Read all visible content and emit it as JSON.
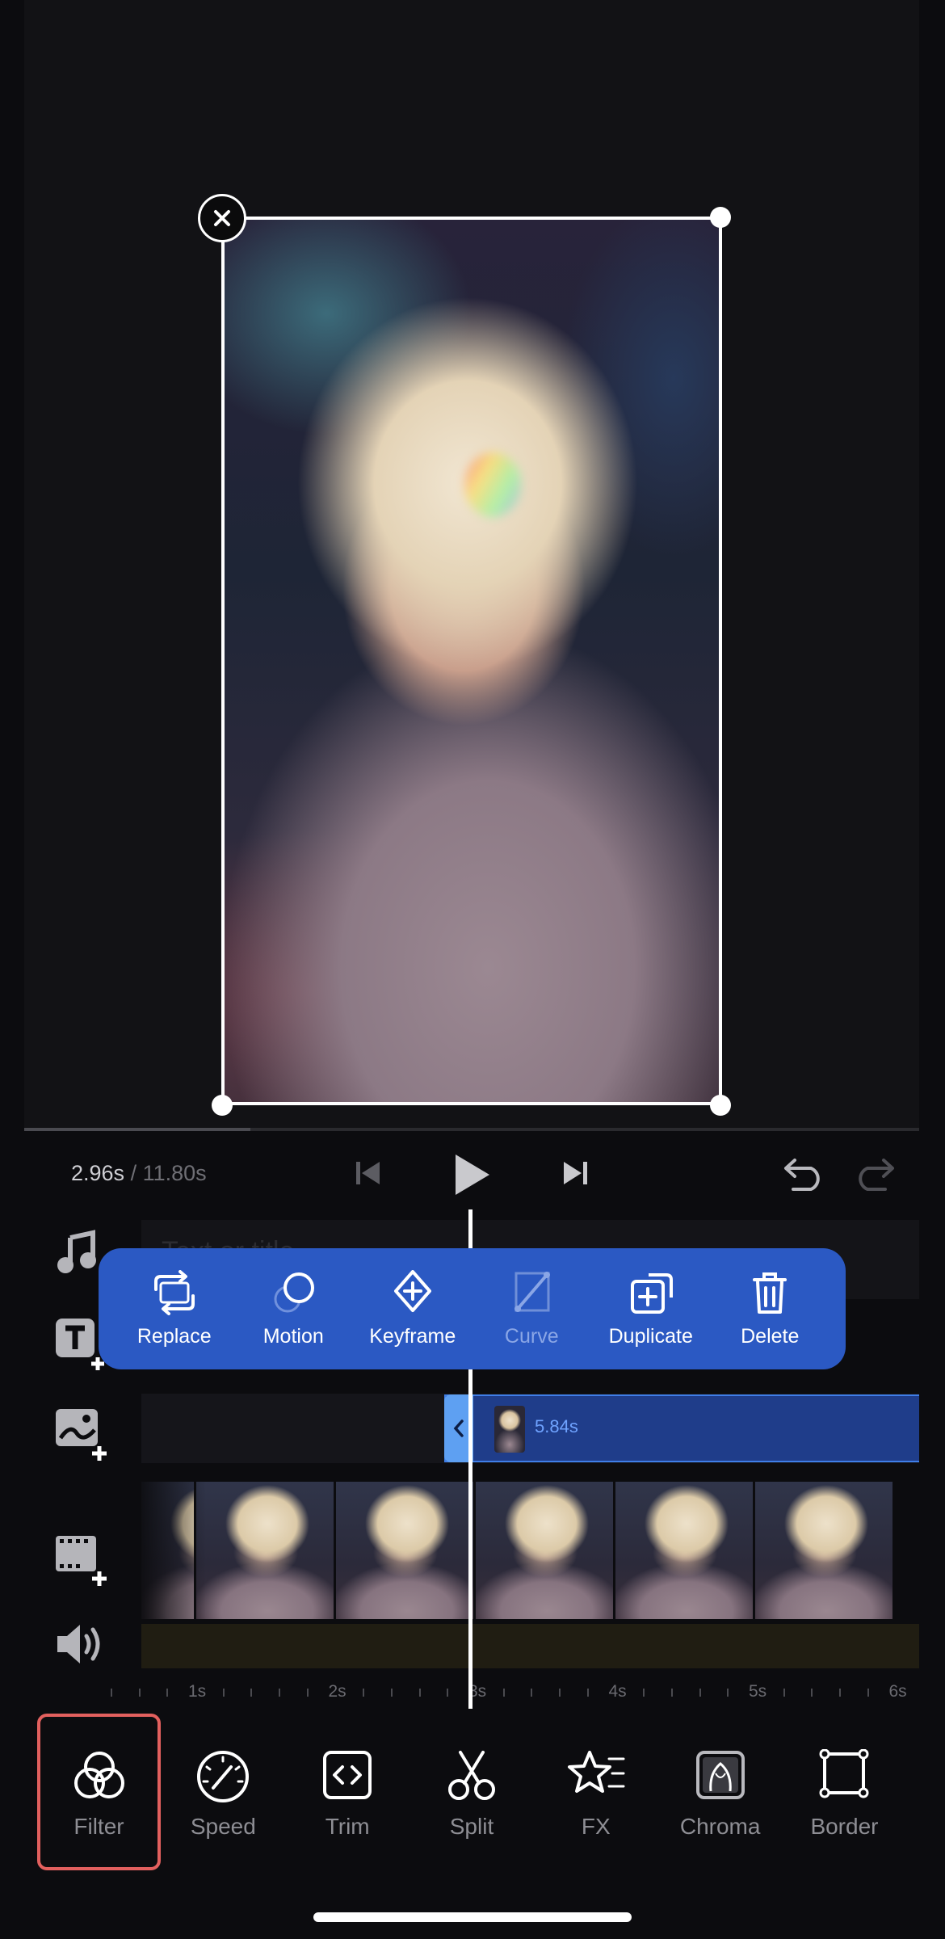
{
  "playback": {
    "current_time": "2.96s",
    "separator": "/",
    "total_time": "11.80s"
  },
  "timeline": {
    "text_track_placeholder": "Text or title...",
    "overlay_clip_duration": "5.84s",
    "ruler_labels": [
      "1s",
      "2s",
      "3s",
      "4s",
      "5s",
      "6s"
    ]
  },
  "popup_menu": [
    {
      "label": "Replace",
      "icon": "replace-icon",
      "enabled": true
    },
    {
      "label": "Motion",
      "icon": "motion-icon",
      "enabled": true
    },
    {
      "label": "Keyframe",
      "icon": "keyframe-icon",
      "enabled": true
    },
    {
      "label": "Curve",
      "icon": "curve-icon",
      "enabled": false
    },
    {
      "label": "Duplicate",
      "icon": "duplicate-icon",
      "enabled": true
    },
    {
      "label": "Delete",
      "icon": "delete-icon",
      "enabled": true
    }
  ],
  "toolbar": [
    {
      "label": "Filter",
      "icon": "filter-icon",
      "selected": true
    },
    {
      "label": "Speed",
      "icon": "speed-icon"
    },
    {
      "label": "Trim",
      "icon": "trim-icon"
    },
    {
      "label": "Split",
      "icon": "split-icon"
    },
    {
      "label": "FX",
      "icon": "fx-icon"
    },
    {
      "label": "Chroma",
      "icon": "chroma-icon"
    },
    {
      "label": "Border",
      "icon": "border-icon"
    }
  ],
  "colors": {
    "popup_bg": "#2b59c3",
    "clip_accent": "#5ea0f2",
    "selection_outline": "#e2605e"
  }
}
